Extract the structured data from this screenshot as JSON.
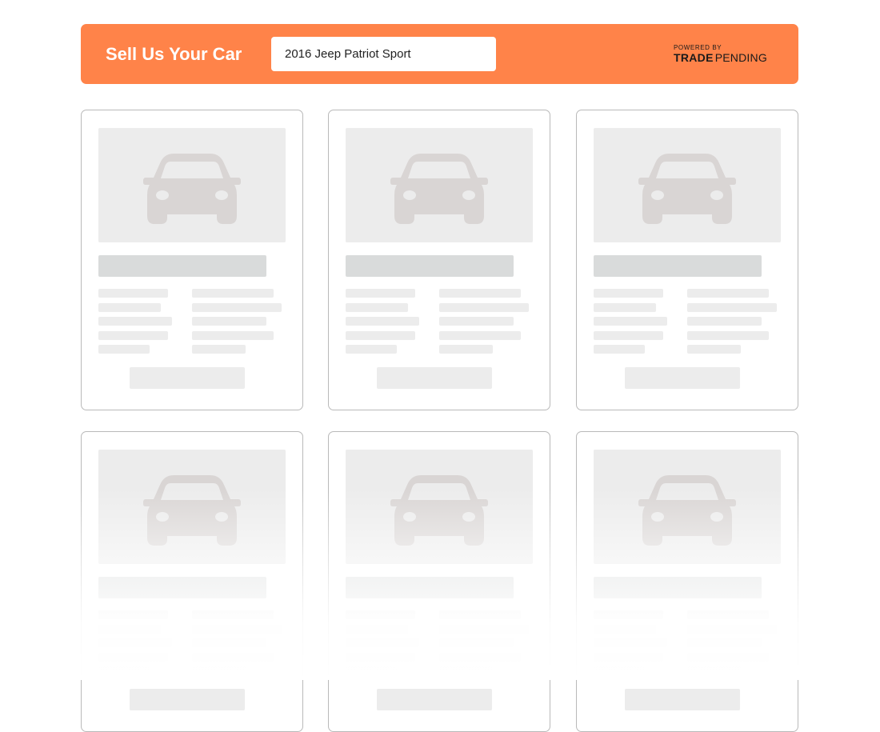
{
  "header": {
    "title": "Sell Us Your Car",
    "vehicle_input_value": "2016 Jeep Patriot Sport",
    "powered_by_label": "POWERED BY",
    "brand_bold": "TRADE",
    "brand_light": "PENDING",
    "background_color": "#ff8349"
  },
  "cards": [
    {
      "state": "loading-placeholder",
      "icon": "car-icon"
    },
    {
      "state": "loading-placeholder",
      "icon": "car-icon"
    },
    {
      "state": "loading-placeholder",
      "icon": "car-icon"
    },
    {
      "state": "loading-placeholder",
      "icon": "car-icon"
    },
    {
      "state": "loading-placeholder",
      "icon": "car-icon"
    },
    {
      "state": "loading-placeholder",
      "icon": "car-icon"
    }
  ],
  "colors": {
    "placeholder_light": "#ececec",
    "placeholder_title": "#d9dbdb",
    "car_silhouette": "#d9d5d4",
    "card_border": "#b9b9b9"
  }
}
